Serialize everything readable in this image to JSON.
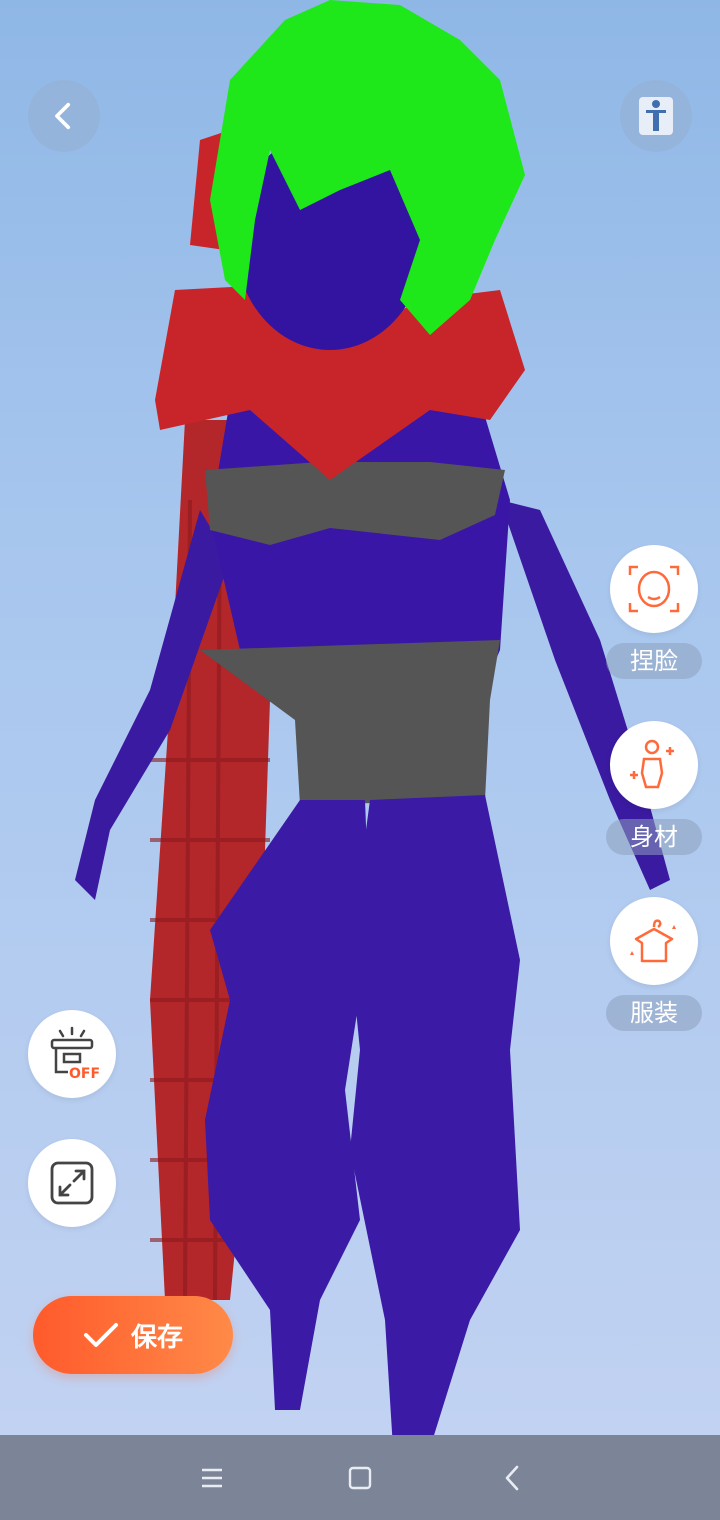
{
  "side_menu": {
    "face_label": "捏脸",
    "body_label": "身材",
    "clothing_label": "服装"
  },
  "left_tools": {
    "off_badge": "OFF"
  },
  "save_button": {
    "label": "保存"
  },
  "colors": {
    "accent": "#ff6a3a",
    "sky_top": "#8fb7e6",
    "sky_bottom": "#c4d3f2",
    "nav_bar": "#7c8597"
  },
  "icons": [
    "back-arrow-icon",
    "accessibility-icon",
    "face-icon",
    "body-icon",
    "clothing-icon",
    "lamp-off-icon",
    "expand-icon",
    "checkmark-icon",
    "menu-icon",
    "home-icon",
    "nav-back-icon"
  ]
}
